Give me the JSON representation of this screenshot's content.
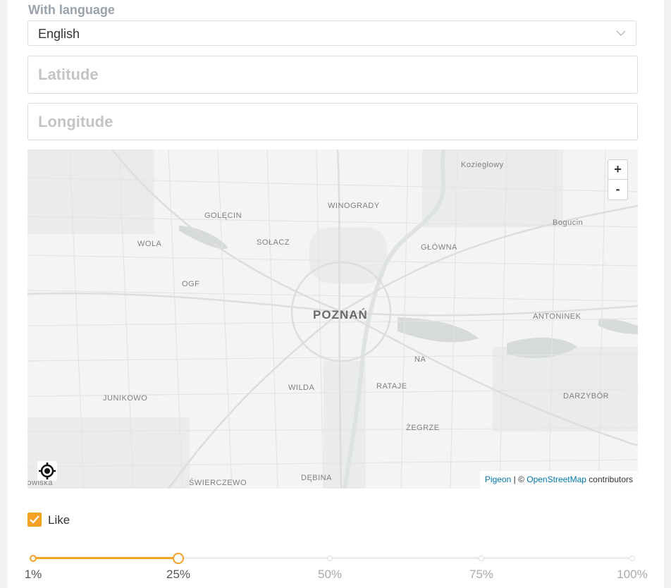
{
  "form": {
    "language_label": "With language",
    "language_value": "English",
    "latitude_placeholder": "Latitude",
    "longitude_placeholder": "Longitude",
    "latitude_value": "",
    "longitude_value": ""
  },
  "map": {
    "zoom_in": "+",
    "zoom_out": "-",
    "places": {
      "koziegl": "Koziegłowy",
      "golecin": "GOLĘCIN",
      "winogrady": "WINOGRADY",
      "bogucin": "Bogucin",
      "wola": "WOLA",
      "solacz": "SOŁACZ",
      "glowna": "GŁÓWNA",
      "ogr": "OGF",
      "poznan": "POZNAŃ",
      "antoninek": "ANTONINEK",
      "na": "NA",
      "junikowo": "JUNIKOWO",
      "wilda": "WILDA",
      "rataje": "RATAJE",
      "darzybor": "DARZYBÓR",
      "zegrze": "ŻEGRZE",
      "dwiska": "ɔwiska",
      "swierczewo": "ŚWIERCZEWO",
      "debina": "DĘBINA"
    },
    "attribution": {
      "pigeon": "Pigeon",
      "separator": " | © ",
      "osm": "OpenStreetMap",
      "suffix": " contributors"
    }
  },
  "like": {
    "label": "Like",
    "checked": true
  },
  "slider": {
    "ticks": [
      "1%",
      "25%",
      "50%",
      "75%",
      "100%"
    ],
    "selected_index": 1
  },
  "colors": {
    "accent": "#f4a124",
    "label": "#9aa3ac",
    "link": "#0078a8"
  }
}
